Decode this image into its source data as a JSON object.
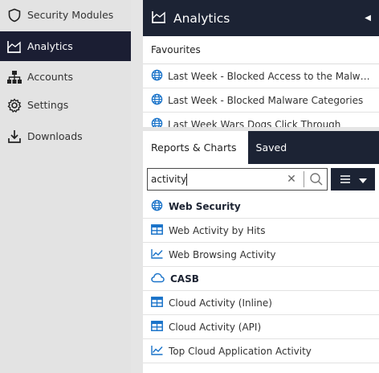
{
  "sidebar": {
    "items": [
      {
        "label": "Security Modules",
        "icon": "shield-icon"
      },
      {
        "label": "Analytics",
        "icon": "analytics-icon",
        "active": true
      },
      {
        "label": "Accounts",
        "icon": "accounts-icon"
      },
      {
        "label": "Settings",
        "icon": "gear-icon"
      },
      {
        "label": "Downloads",
        "icon": "download-icon"
      }
    ]
  },
  "analytics_panel": {
    "title": "Analytics",
    "favourites_label": "Favourites",
    "favourites": [
      "Last Week - Blocked Access to the Malware Ca...",
      "Last Week - Blocked Malware Categories",
      "Last Week Wars Dogs Click Through"
    ]
  },
  "reports_panel": {
    "tabs": [
      "Reports & Charts",
      "Saved"
    ],
    "search": {
      "value": "activity"
    },
    "groups": [
      {
        "label": "Web Security",
        "icon": "globe-icon"
      },
      {
        "label": "CASB",
        "icon": "cloud-icon"
      }
    ],
    "rows": [
      {
        "label": "Web Activity by Hits",
        "icon": "table-icon"
      },
      {
        "label": "Web Browsing Activity",
        "icon": "line-chart-icon"
      },
      {
        "label": "Cloud Activity (Inline)",
        "icon": "table-icon"
      },
      {
        "label": "Cloud Activity (API)",
        "icon": "table-icon"
      },
      {
        "label": "Top Cloud Application Activity",
        "icon": "line-chart-icon"
      }
    ]
  },
  "colors": {
    "accent": "#1a73c9",
    "navy": "#1c2334"
  }
}
